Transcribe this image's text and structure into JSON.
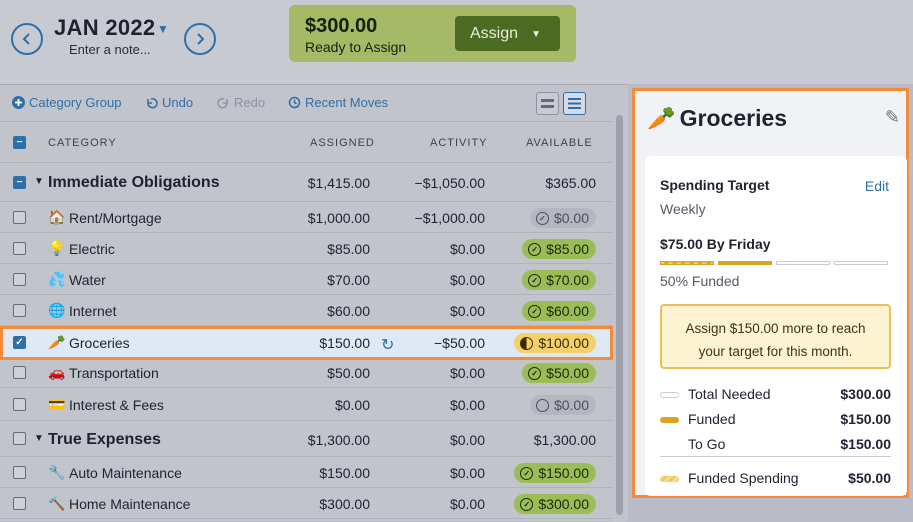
{
  "header": {
    "month": "JAN 2022",
    "note_placeholder": "Enter a note...",
    "ready_amount": "$300.00",
    "ready_label": "Ready to Assign",
    "assign_label": "Assign"
  },
  "toolbar": {
    "category_group": "Category Group",
    "undo": "Undo",
    "redo": "Redo",
    "recent_moves": "Recent Moves"
  },
  "columns": {
    "category": "CATEGORY",
    "assigned": "ASSIGNED",
    "activity": "ACTIVITY",
    "available": "AVAILABLE"
  },
  "groups": [
    {
      "name": "Immediate Obligations",
      "assigned": "$1,415.00",
      "activity": "−$1,050.00",
      "available": "$365.00"
    },
    {
      "name": "True Expenses",
      "assigned": "$1,300.00",
      "activity": "$0.00",
      "available": "$1,300.00"
    }
  ],
  "rows": [
    {
      "icon": "🏠",
      "name": "Rent/Mortgage",
      "assigned": "$1,000.00",
      "activity": "−$1,000.00",
      "available": "$0.00",
      "status": "gray"
    },
    {
      "icon": "💡",
      "name": "Electric",
      "assigned": "$85.00",
      "activity": "$0.00",
      "available": "$85.00",
      "status": "green"
    },
    {
      "icon": "💦",
      "name": "Water",
      "assigned": "$70.00",
      "activity": "$0.00",
      "available": "$70.00",
      "status": "green"
    },
    {
      "icon": "🌐",
      "name": "Internet",
      "assigned": "$60.00",
      "activity": "$0.00",
      "available": "$60.00",
      "status": "green"
    },
    {
      "icon": "🥕",
      "name": "Groceries",
      "assigned": "$150.00",
      "activity": "−$50.00",
      "available": "$100.00",
      "status": "yellow"
    },
    {
      "icon": "🚗",
      "name": "Transportation",
      "assigned": "$50.00",
      "activity": "$0.00",
      "available": "$50.00",
      "status": "green"
    },
    {
      "icon": "💳",
      "name": "Interest & Fees",
      "assigned": "$0.00",
      "activity": "$0.00",
      "available": "$0.00",
      "status": "gray"
    },
    {
      "icon": "🔧",
      "name": "Auto Maintenance",
      "assigned": "$150.00",
      "activity": "$0.00",
      "available": "$150.00",
      "status": "green"
    },
    {
      "icon": "🔨",
      "name": "Home  Maintenance",
      "assigned": "$300.00",
      "activity": "$0.00",
      "available": "$300.00",
      "status": "green"
    }
  ],
  "inspector": {
    "icon": "🥕",
    "title": "Groceries",
    "target_title": "Spending Target",
    "edit": "Edit",
    "frequency": "Weekly",
    "goal": "$75.00 By Friday",
    "funded_pct_label": "50% Funded",
    "funded_fraction": 0.5,
    "message": "Assign $150.00 more to reach your target for this month.",
    "legend": [
      {
        "label": "Total Needed",
        "value": "$300.00"
      },
      {
        "label": "Funded",
        "value": "$150.00"
      },
      {
        "label": "To Go",
        "value": "$150.00"
      },
      {
        "label": "Funded Spending",
        "value": "$50.00"
      }
    ]
  },
  "colors": {
    "accent": "#2e6fa8",
    "ready_bg": "#a5b966",
    "assign_btn": "#4c6b22",
    "highlight": "#f28c3c",
    "funded": "#d9a520"
  }
}
